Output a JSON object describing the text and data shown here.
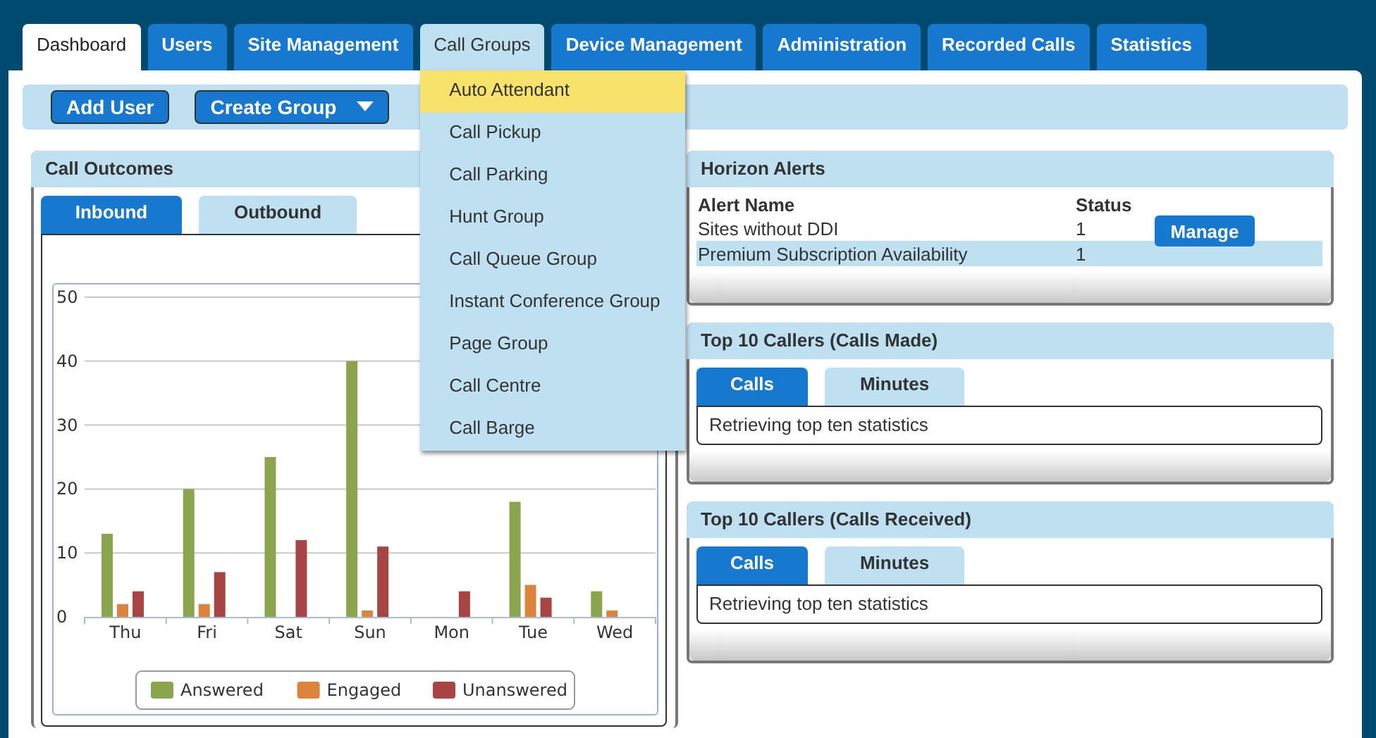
{
  "tabs": [
    {
      "label": "Dashboard",
      "selected": true
    },
    {
      "label": "Users",
      "selected": false
    },
    {
      "label": "Site Management",
      "selected": false
    },
    {
      "label": "Call Groups",
      "selected": false,
      "open": true
    },
    {
      "label": "Device Management",
      "selected": false
    },
    {
      "label": "Administration",
      "selected": false
    },
    {
      "label": "Recorded Calls",
      "selected": false
    },
    {
      "label": "Statistics",
      "selected": false
    }
  ],
  "toolbar": {
    "buttons": [
      {
        "label": "Add User",
        "kind": "plain"
      },
      {
        "label": "Create Group",
        "kind": "dropdown"
      }
    ]
  },
  "menu": {
    "items": [
      {
        "label": "Auto Attendant",
        "selected": true
      },
      {
        "label": "Call Pickup",
        "selected": false
      },
      {
        "label": "Call Parking",
        "selected": false
      },
      {
        "label": "Hunt Group",
        "selected": false
      },
      {
        "label": "Call Queue Group",
        "selected": false
      },
      {
        "label": "Instant Conference Group",
        "selected": false
      },
      {
        "label": "Page Group",
        "selected": false
      },
      {
        "label": "Call Centre",
        "selected": false
      },
      {
        "label": "Call Barge",
        "selected": false
      }
    ]
  },
  "call_outcomes": {
    "title": "Call Outcomes",
    "tabs": [
      {
        "label": "Inbound",
        "selected": true
      },
      {
        "label": "Outbound",
        "selected": false
      }
    ],
    "chart_data": {
      "type": "bar",
      "grid": true,
      "legend": true,
      "categories": [
        "Thu",
        "Fri",
        "Sat",
        "Sun",
        "Mon",
        "Tue",
        "Wed"
      ],
      "ylim": [
        0,
        50
      ],
      "yticks": [
        0,
        10,
        20,
        30,
        40,
        50
      ],
      "series": [
        {
          "name": "Answered",
          "color": "#8aa54e",
          "values": [
            13,
            20,
            25,
            40,
            null,
            18,
            4
          ]
        },
        {
          "name": "Engaged",
          "color": "#dd843c",
          "values": [
            2,
            2,
            0,
            1,
            0,
            5,
            1
          ]
        },
        {
          "name": "Unanswered",
          "color": "#a94444",
          "values": [
            4,
            7,
            12,
            11,
            4,
            3,
            0
          ]
        }
      ]
    }
  },
  "alerts": {
    "title": "Horizon Alerts",
    "columns": [
      "Alert Name",
      "Status"
    ],
    "rows": [
      {
        "name": "Sites without DDI",
        "status": "1",
        "action": "Manage",
        "selected": false
      },
      {
        "name": "Premium Subscription Availability",
        "status": "1",
        "selected": true
      }
    ]
  },
  "callers": [
    {
      "title": "Top 10 Callers (Calls Made)",
      "tabs": [
        {
          "label": "Calls",
          "selected": true
        },
        {
          "label": "Minutes",
          "selected": false
        }
      ],
      "message": "Retrieving top ten statistics"
    },
    {
      "title": "Top 10 Callers (Calls Received)",
      "tabs": [
        {
          "label": "Calls",
          "selected": true
        },
        {
          "label": "Minutes",
          "selected": false
        }
      ],
      "message": "Retrieving top ten statistics"
    }
  ]
}
